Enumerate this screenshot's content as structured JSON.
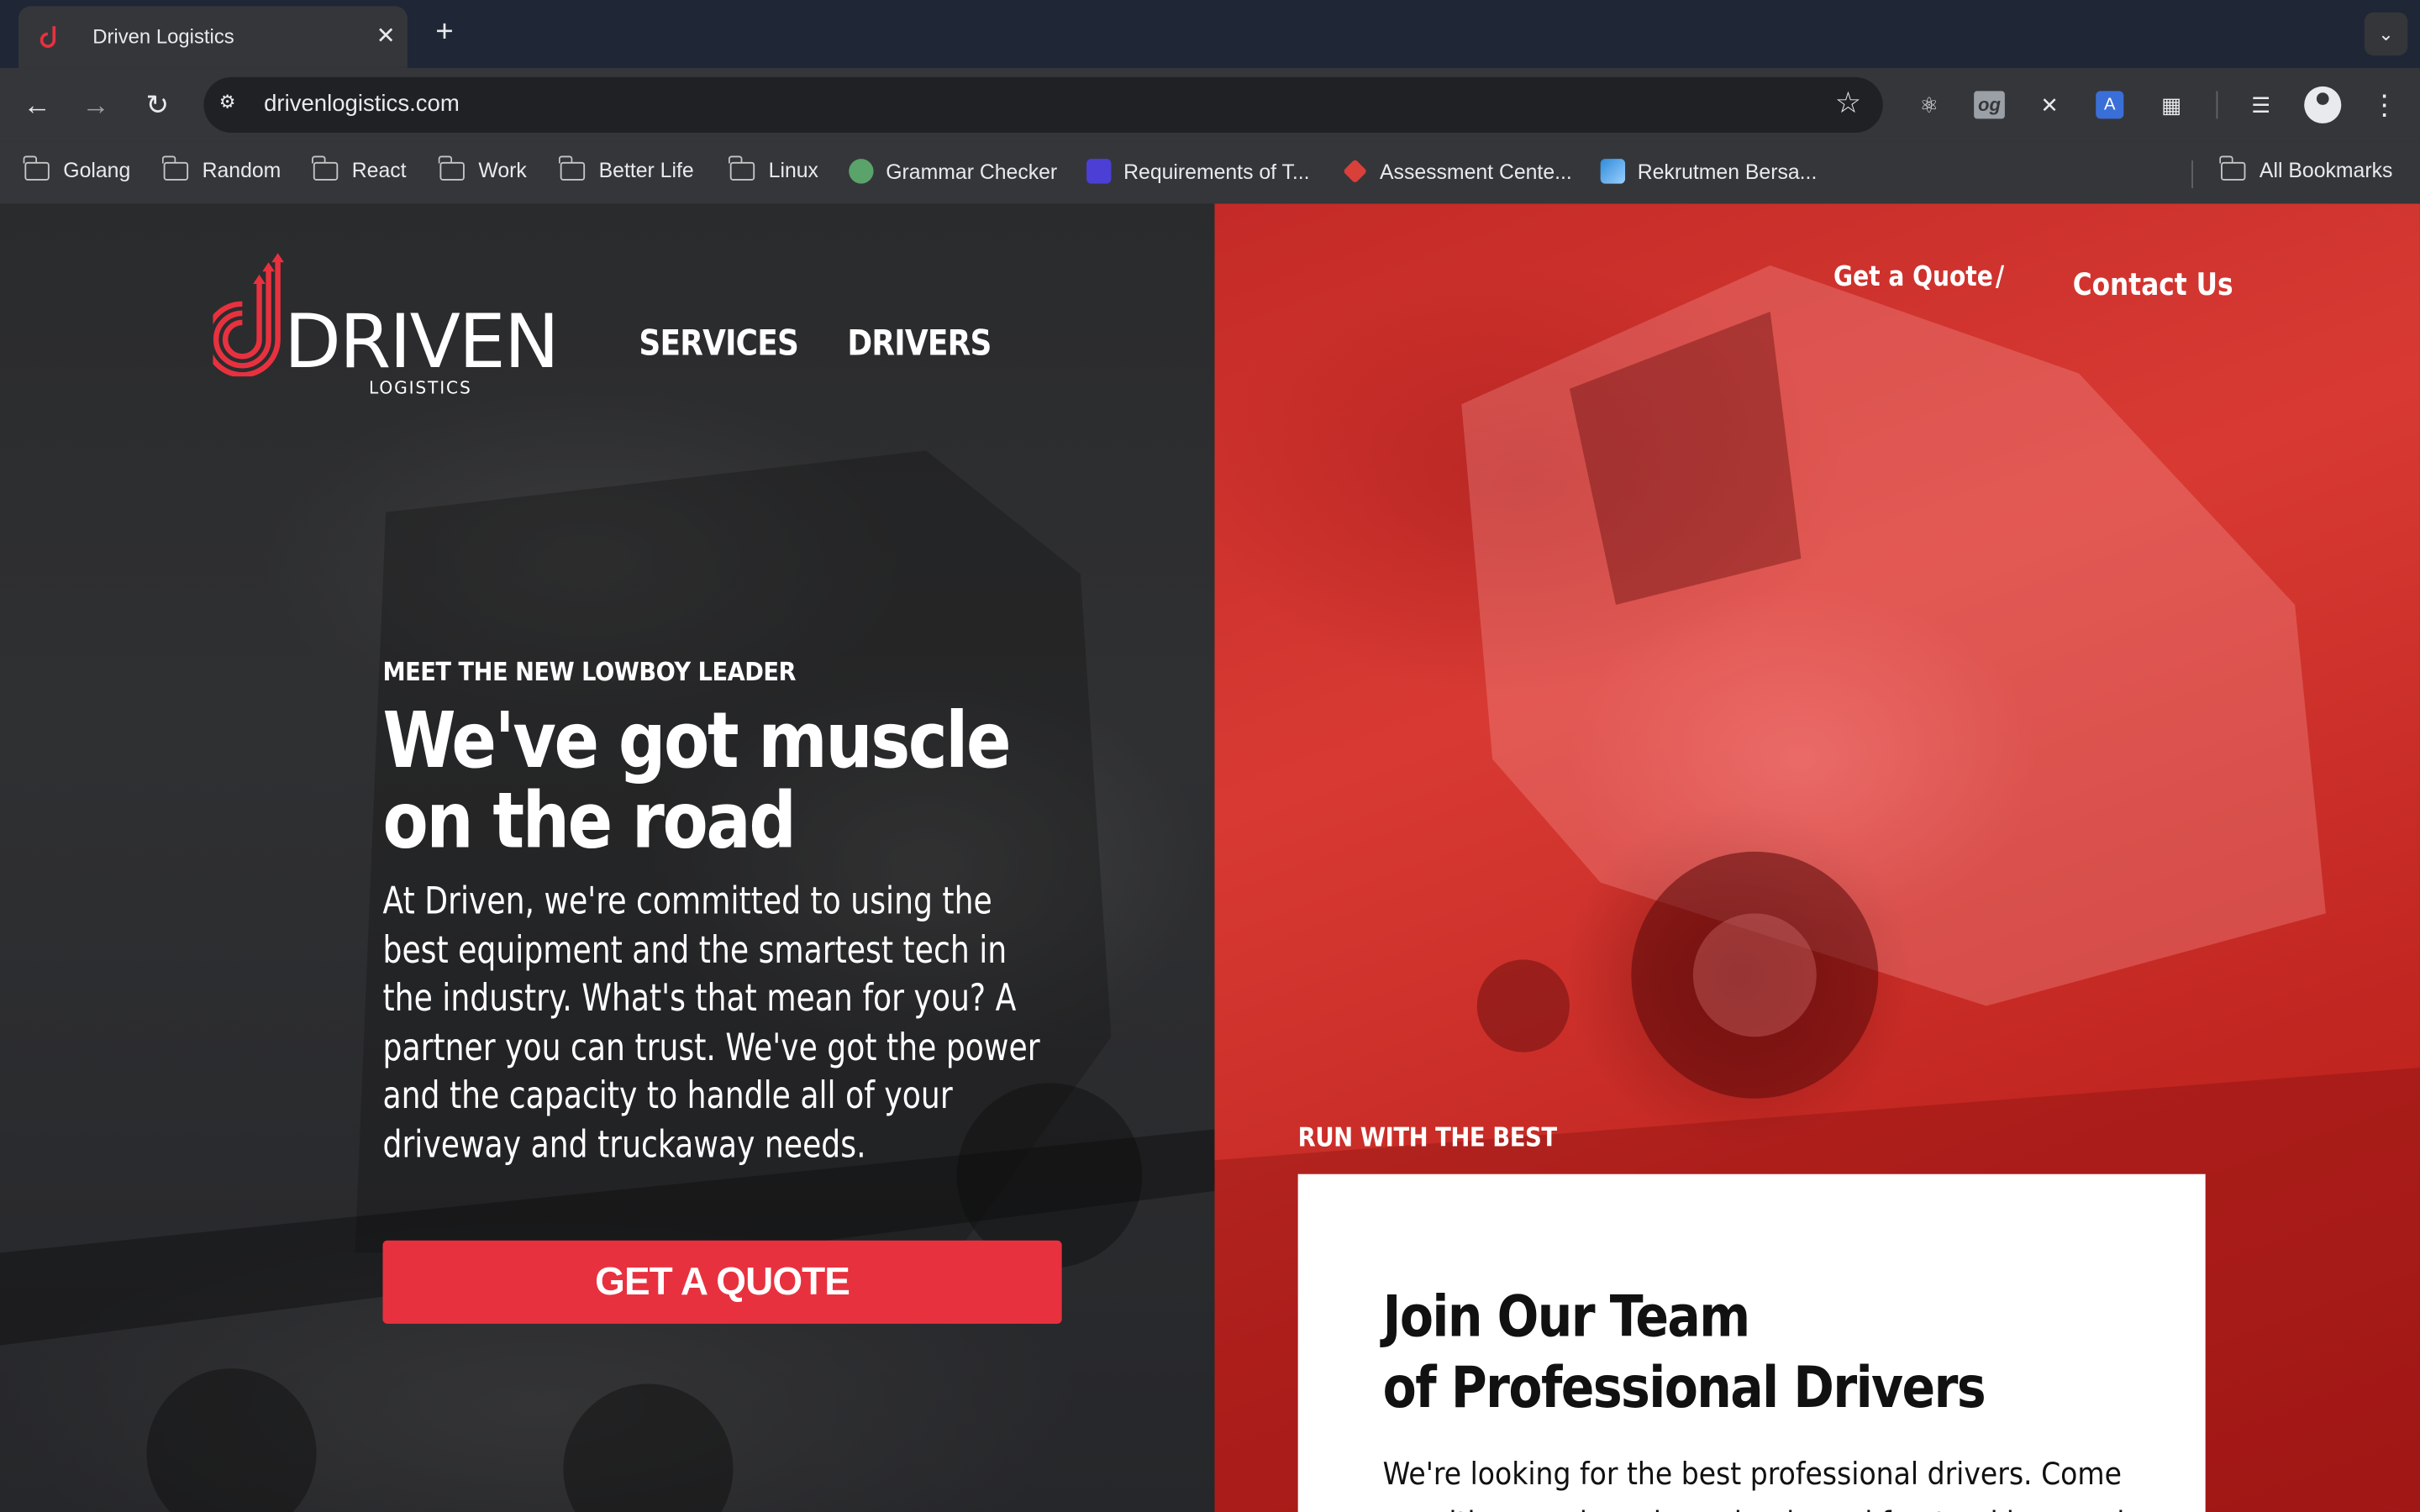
{
  "browser": {
    "tab_title": "Driven Logistics",
    "tab_close": "✕",
    "new_tab": "+",
    "url": "drivenlogistics.com",
    "bookmarks": [
      {
        "label": "Golang",
        "type": "folder"
      },
      {
        "label": "Random",
        "type": "folder"
      },
      {
        "label": "React",
        "type": "folder"
      },
      {
        "label": "Work",
        "type": "folder"
      },
      {
        "label": "Better Life",
        "type": "folder"
      },
      {
        "label": "Linux",
        "type": "folder"
      },
      {
        "label": "Grammar Checker",
        "type": "site"
      },
      {
        "label": "Requirements of T...",
        "type": "site"
      },
      {
        "label": "Assessment Cente...",
        "type": "site"
      },
      {
        "label": "Rekrutmen Bersa...",
        "type": "site"
      }
    ],
    "all_bookmarks": "All Bookmarks",
    "extension_og": "og",
    "extension_translate": "A"
  },
  "site": {
    "logo_word": "DRIVEN",
    "logo_sub": "LOGISTICS",
    "nav": {
      "services": "SERVICES",
      "drivers": "DRIVERS"
    },
    "top_links": {
      "get_quote": "Get a Quote",
      "separator": "/",
      "contact": "Contact Us"
    },
    "hero": {
      "eyebrow": "MEET THE NEW LOWBOY LEADER",
      "headline_1": "We've got muscle",
      "headline_2": "on the road",
      "body": "At Driven, we're committed to using the best equipment and the smartest tech in the industry. What's that mean for you? A partner you can trust. We've got the power and the capacity to handle all of your driveway and truckaway needs.",
      "cta": "GET A QUOTE"
    },
    "drivers_section": {
      "eyebrow": "RUN WITH THE BEST",
      "title_1": "Join Our Team",
      "title_2": "of Professional Drivers",
      "body": "We're looking for the best professional drivers. Come on with us and see how simple and fun trucking can be."
    }
  },
  "colors": {
    "accent_red": "#e8313f",
    "panel_red": "#c42a27",
    "dark_panel": "#2a2b2d"
  }
}
